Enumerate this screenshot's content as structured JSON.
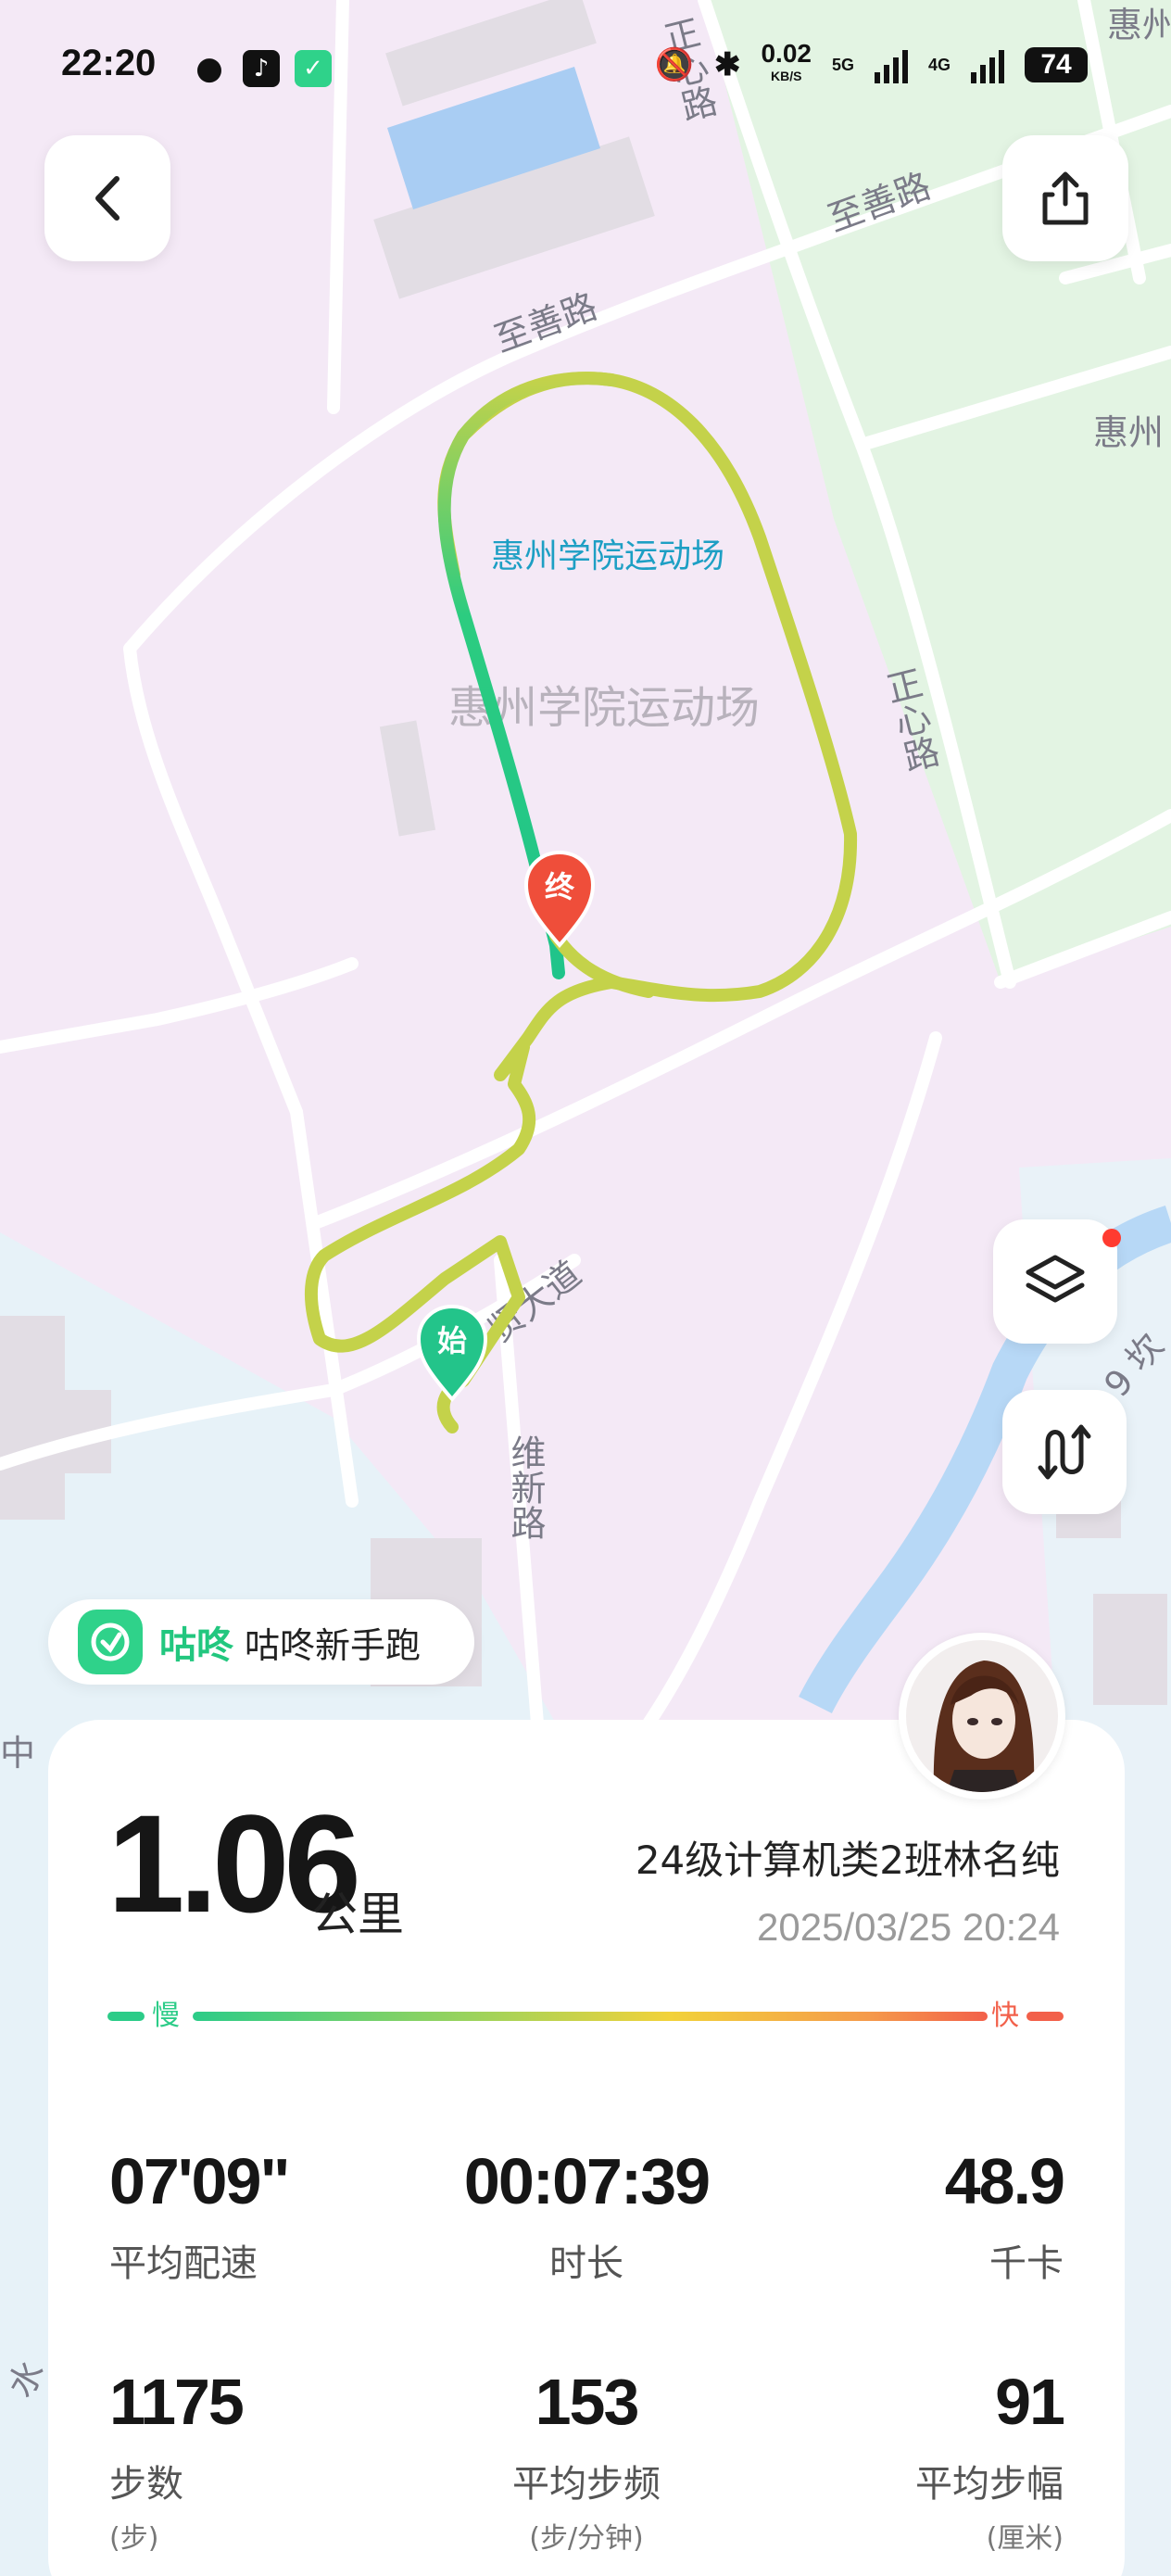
{
  "status_bar": {
    "time": "22:20",
    "net_speed": "0.02",
    "net_unit": "KB/S",
    "sim1": "5G",
    "sim2": "4G",
    "battery": "74"
  },
  "map": {
    "labels": {
      "zhishan_road_1": "至善路",
      "zhishan_road_2": "至善路",
      "zhengxin_road_1": "正心路",
      "zhengxin_road_2": "正心路",
      "stadium_marker": "惠州学院运动场",
      "stadium_area": "惠州学院运动场",
      "xian_avenue": "贤大道",
      "weixin_road": "维新路",
      "foreign_lang": "惠州外语",
      "hui_label": "惠州",
      "zhong_label": "中",
      "water_label": "水",
      "nine_label": "9 坎"
    },
    "marker_start": "始",
    "marker_end": "终",
    "route_colors": {
      "slow": "#c4d24a",
      "fast": "#1fc48a",
      "end_marker": "#ef4e3a",
      "start_marker": "#23c48a"
    }
  },
  "brand": {
    "name": "咕咚",
    "subtitle": "咕咚新手跑"
  },
  "summary": {
    "distance": "1.06",
    "distance_unit": "公里",
    "username": "24级计算机类2班林名纯",
    "datetime": "2025/03/25 20:24",
    "pace_slow_label": "慢",
    "pace_fast_label": "快"
  },
  "stats": [
    {
      "value": "07'09\"",
      "label": "平均配速",
      "unit": ""
    },
    {
      "value": "00:07:39",
      "label": "时长",
      "unit": ""
    },
    {
      "value": "48.9",
      "label": "千卡",
      "unit": ""
    },
    {
      "value": "1175",
      "label": "步数",
      "unit": "(步)"
    },
    {
      "value": "153",
      "label": "平均步频",
      "unit": "(步/分钟)"
    },
    {
      "value": "91",
      "label": "平均步幅",
      "unit": "(厘米)"
    }
  ],
  "icons": {
    "back": "chevron-left-icon",
    "share": "share-icon",
    "layers": "layers-icon",
    "route_mode": "route-icon"
  }
}
